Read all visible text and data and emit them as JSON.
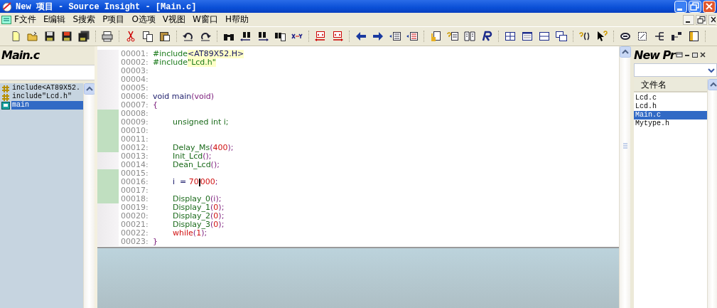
{
  "window": {
    "title": "New 项目 - Source Insight - [Main.c]"
  },
  "menu": [
    "F文件",
    "E编辑",
    "S搜索",
    "P项目",
    "O选项",
    "V视图",
    "W窗口",
    "H帮助"
  ],
  "symbol_panel": {
    "title": "Main.c",
    "items": [
      {
        "label": "include<AT89X52.",
        "kind": "include",
        "selected": false
      },
      {
        "label": "include\"Lcd.h\"",
        "kind": "include",
        "selected": false
      },
      {
        "label": "main",
        "kind": "function",
        "selected": true
      }
    ]
  },
  "editor": {
    "lines": [
      {
        "number": "00001:",
        "modified": false,
        "indent": false,
        "tokens": [
          {
            "text": "#include",
            "kind": "directive"
          },
          {
            "text": "<AT89X52.H>",
            "kind": "header"
          }
        ]
      },
      {
        "number": "00002:",
        "modified": false,
        "indent": false,
        "tokens": [
          {
            "text": "#include",
            "kind": "directive"
          },
          {
            "text": "\"Lcd.h\"",
            "kind": "string"
          }
        ]
      },
      {
        "number": "00003:",
        "modified": false
      },
      {
        "number": "00004:",
        "modified": false
      },
      {
        "number": "00005:",
        "modified": false
      },
      {
        "number": "00006:",
        "modified": false,
        "indent": false,
        "tokens": [
          {
            "text": "void main",
            "kind": "keyword"
          },
          {
            "text": "(void)",
            "kind": "punct"
          }
        ]
      },
      {
        "number": "00007:",
        "modified": false,
        "indent": false,
        "tokens": [
          {
            "text": "{",
            "kind": "punct"
          }
        ]
      },
      {
        "number": "00008:",
        "modified": true
      },
      {
        "number": "00009:",
        "modified": true,
        "indent": true,
        "tokens": [
          {
            "text": "unsigned int i;",
            "kind": "call"
          }
        ]
      },
      {
        "number": "00010:",
        "modified": true
      },
      {
        "number": "00011:",
        "modified": true
      },
      {
        "number": "00012:",
        "modified": true,
        "indent": true,
        "tokens": [
          {
            "text": "Delay_Ms",
            "kind": "call"
          },
          {
            "text": "(",
            "kind": "punct"
          },
          {
            "text": "400",
            "kind": "number"
          },
          {
            "text": ");",
            "kind": "punct"
          }
        ]
      },
      {
        "number": "00013:",
        "modified": false,
        "indent": true,
        "tokens": [
          {
            "text": "Init_Lcd",
            "kind": "call"
          },
          {
            "text": "();",
            "kind": "punct"
          }
        ]
      },
      {
        "number": "00014:",
        "modified": false,
        "indent": true,
        "tokens": [
          {
            "text": "Dean_Lcd",
            "kind": "call"
          },
          {
            "text": "();",
            "kind": "punct"
          }
        ]
      },
      {
        "number": "00015:",
        "modified": true
      },
      {
        "number": "00016:",
        "modified": true,
        "indent": true,
        "tokens": [
          {
            "text": "i  = ",
            "kind": "keyword"
          },
          {
            "text": "70",
            "kind": "number",
            "caret_after": true
          },
          {
            "text": "000",
            "kind": "number"
          },
          {
            "text": ";",
            "kind": "punct"
          }
        ]
      },
      {
        "number": "00017:",
        "modified": true
      },
      {
        "number": "00018:",
        "modified": true,
        "indent": true,
        "tokens": [
          {
            "text": "Display_0",
            "kind": "call"
          },
          {
            "text": "(i);",
            "kind": "punct"
          }
        ]
      },
      {
        "number": "00019:",
        "modified": false,
        "indent": true,
        "tokens": [
          {
            "text": "Display_1",
            "kind": "call"
          },
          {
            "text": "(",
            "kind": "punct"
          },
          {
            "text": "0",
            "kind": "number"
          },
          {
            "text": ");",
            "kind": "punct"
          }
        ]
      },
      {
        "number": "00020:",
        "modified": false,
        "indent": true,
        "tokens": [
          {
            "text": "Display_2",
            "kind": "call"
          },
          {
            "text": "(",
            "kind": "punct"
          },
          {
            "text": "0",
            "kind": "number"
          },
          {
            "text": ");",
            "kind": "punct"
          }
        ]
      },
      {
        "number": "00021:",
        "modified": false,
        "indent": true,
        "tokens": [
          {
            "text": "Display_3",
            "kind": "call"
          },
          {
            "text": "(",
            "kind": "punct"
          },
          {
            "text": "0",
            "kind": "number"
          },
          {
            "text": ");",
            "kind": "punct"
          }
        ]
      },
      {
        "number": "00022:",
        "modified": false,
        "indent": true,
        "tokens": [
          {
            "text": "while",
            "kind": "reserved"
          },
          {
            "text": "(",
            "kind": "punct"
          },
          {
            "text": "1",
            "kind": "number"
          },
          {
            "text": ");",
            "kind": "punct"
          }
        ]
      },
      {
        "number": "00023:",
        "modified": false,
        "indent": false,
        "tokens": [
          {
            "text": "}",
            "kind": "punct"
          }
        ]
      }
    ]
  },
  "project_panel": {
    "title": "New Pr",
    "column": "文件名",
    "files": [
      {
        "name": "Lcd.c",
        "selected": false
      },
      {
        "name": "Lcd.h",
        "selected": false
      },
      {
        "name": "Main.c",
        "selected": true
      },
      {
        "name": "Mytype.h",
        "selected": false
      }
    ]
  }
}
